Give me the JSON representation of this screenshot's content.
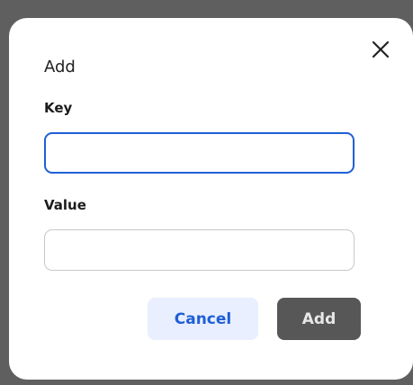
{
  "dialog": {
    "title": "Add",
    "close_icon": "close-icon",
    "key_label": "Key",
    "key_value": "",
    "value_label": "Value",
    "value_value": "",
    "cancel_label": "Cancel",
    "add_label": "Add",
    "colors": {
      "accent": "#1f5fd6",
      "cancel_bg": "#e9efff",
      "add_bg": "#575757",
      "backdrop": "#5f5f5f"
    }
  }
}
